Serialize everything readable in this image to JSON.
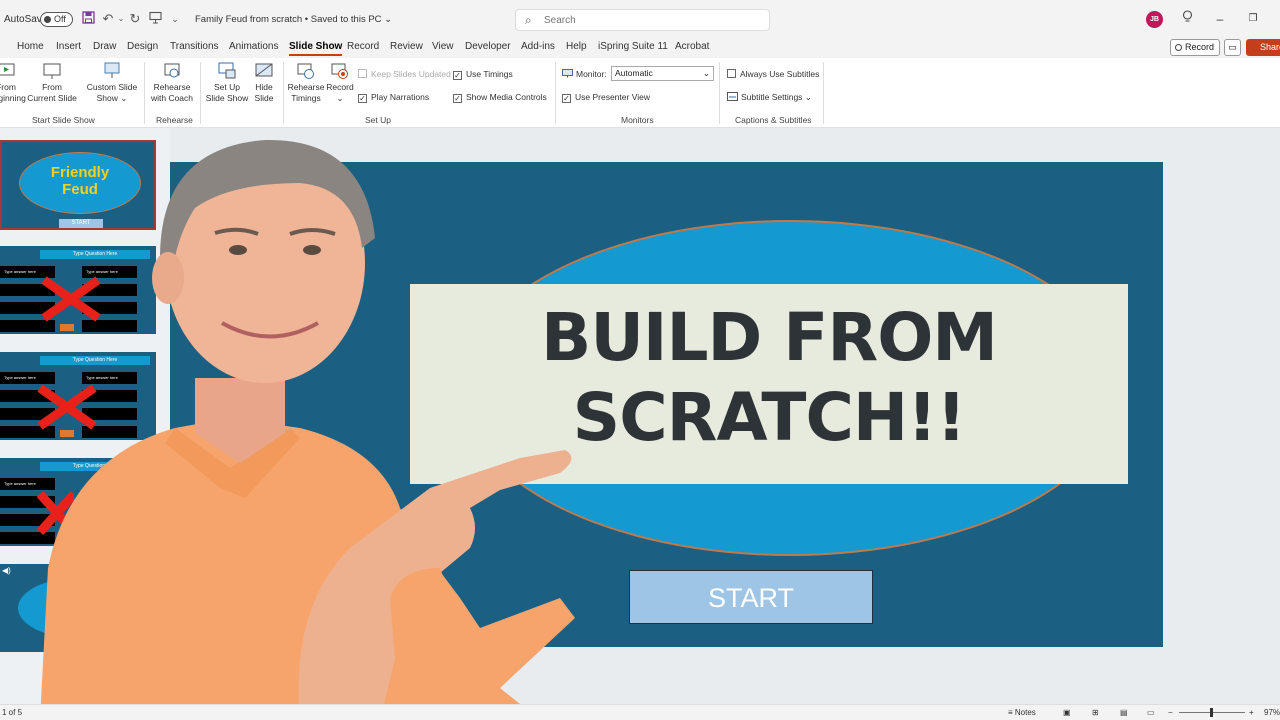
{
  "titlebar": {
    "autosave_label": "AutoSave",
    "autosave_state": "Off",
    "document_title": "Family Feud from scratch • Saved to this PC",
    "search_placeholder": "Search",
    "avatar_initials": "JB"
  },
  "menu": {
    "tabs": [
      "Home",
      "Insert",
      "Draw",
      "Design",
      "Transitions",
      "Animations",
      "Slide Show",
      "Record",
      "Review",
      "View",
      "Developer",
      "Add-ins",
      "Help",
      "iSpring Suite 11",
      "Acrobat"
    ],
    "active_tab": "Slide Show",
    "record_label": "Record",
    "share_label": "Share"
  },
  "ribbon": {
    "start": {
      "from_beginning": "From\nBeginning",
      "from_current": "From\nCurrent Slide",
      "custom": "Custom Slide\nShow",
      "group": "Start Slide Show"
    },
    "rehearse": {
      "coach": "Rehearse\nwith Coach",
      "group": "Rehearse"
    },
    "setup": {
      "set_up": "Set Up\nSlide Show",
      "hide": "Hide\nSlide",
      "timings": "Rehearse\nTimings",
      "record": "Record",
      "keep_updated": "Keep Slides Updated",
      "use_timings": "Use Timings",
      "play_narrations": "Play Narrations",
      "show_media": "Show Media Controls",
      "group": "Set Up"
    },
    "monitors": {
      "monitor_label": "Monitor:",
      "monitor_value": "Automatic",
      "presenter_view": "Use Presenter View",
      "group": "Monitors"
    },
    "captions": {
      "always_subtitles": "Always Use Subtitles",
      "subtitle_settings": "Subtitle Settings",
      "group": "Captions & Subtitles"
    }
  },
  "thumbnails": {
    "slide1_title_line1": "Friendly",
    "slide1_title_line2": "Feud",
    "slide1_start": "START",
    "question": "Type Question Here",
    "answer": "Type answer here"
  },
  "slide": {
    "line1": "BUILD FROM",
    "line2": "SCRATCH!!",
    "start_label": "START"
  },
  "status": {
    "slide_counter": "1 of 5",
    "notes": "Notes",
    "zoom": "97%"
  },
  "colors": {
    "slide_bg": "#1b5f82",
    "ellipse": "#1499d0",
    "accent": "#c43e1c",
    "shirt": "#f6a46c"
  }
}
